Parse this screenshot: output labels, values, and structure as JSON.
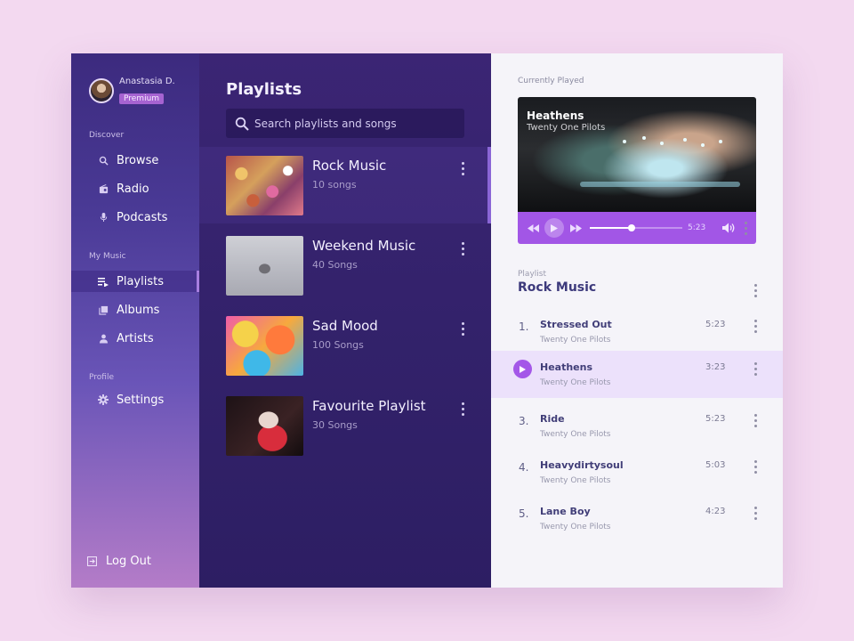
{
  "user": {
    "name": "Anastasia D.",
    "badge": "Premium"
  },
  "sidebar": {
    "discover_label": "Discover",
    "discover": [
      {
        "label": "Browse",
        "icon": "search-icon"
      },
      {
        "label": "Radio",
        "icon": "radio-icon"
      },
      {
        "label": "Podcasts",
        "icon": "microphone-icon"
      }
    ],
    "mymusic_label": "My Music",
    "mymusic": [
      {
        "label": "Playlists",
        "icon": "playlist-icon",
        "active": true
      },
      {
        "label": "Albums",
        "icon": "albums-icon"
      },
      {
        "label": "Artists",
        "icon": "person-icon"
      }
    ],
    "profile_label": "Profile",
    "profile": [
      {
        "label": "Settings",
        "icon": "gear-icon"
      }
    ],
    "logout": "Log Out"
  },
  "playlists": {
    "title": "Playlists",
    "search_placeholder": "Search playlists and songs",
    "items": [
      {
        "name": "Rock Music",
        "count": "10 songs",
        "active": true
      },
      {
        "name": "Weekend Music",
        "count": "40 Songs"
      },
      {
        "name": "Sad Mood",
        "count": "100 Songs"
      },
      {
        "name": "Favourite Playlist",
        "count": "30 Songs"
      }
    ]
  },
  "player": {
    "label": "Currently Played",
    "title": "Heathens",
    "artist": "Twenty One Pilots",
    "time": "5:23",
    "progress": 0.45
  },
  "tracklist": {
    "label": "Playlist",
    "name": "Rock Music",
    "songs": [
      {
        "num": "1.",
        "title": "Stressed Out",
        "artist": "Twenty One Pilots",
        "duration": "5:23"
      },
      {
        "num": "",
        "title": "Heathens",
        "artist": "Twenty One Pilots",
        "duration": "3:23",
        "playing": true
      },
      {
        "num": "3.",
        "title": "Ride",
        "artist": "Twenty One Pilots",
        "duration": "5:23"
      },
      {
        "num": "4.",
        "title": "Heavydirtysoul",
        "artist": "Twenty One Pilots",
        "duration": "5:03"
      },
      {
        "num": "5.",
        "title": "Lane Boy",
        "artist": "Twenty One Pilots",
        "duration": "4:23"
      }
    ]
  },
  "colors": {
    "accent": "#a256e6",
    "sidebar_top": "#3c2a7e",
    "sidebar_bottom": "#b47cc8",
    "panel": "#33226b",
    "background": "#f3d9f0"
  }
}
